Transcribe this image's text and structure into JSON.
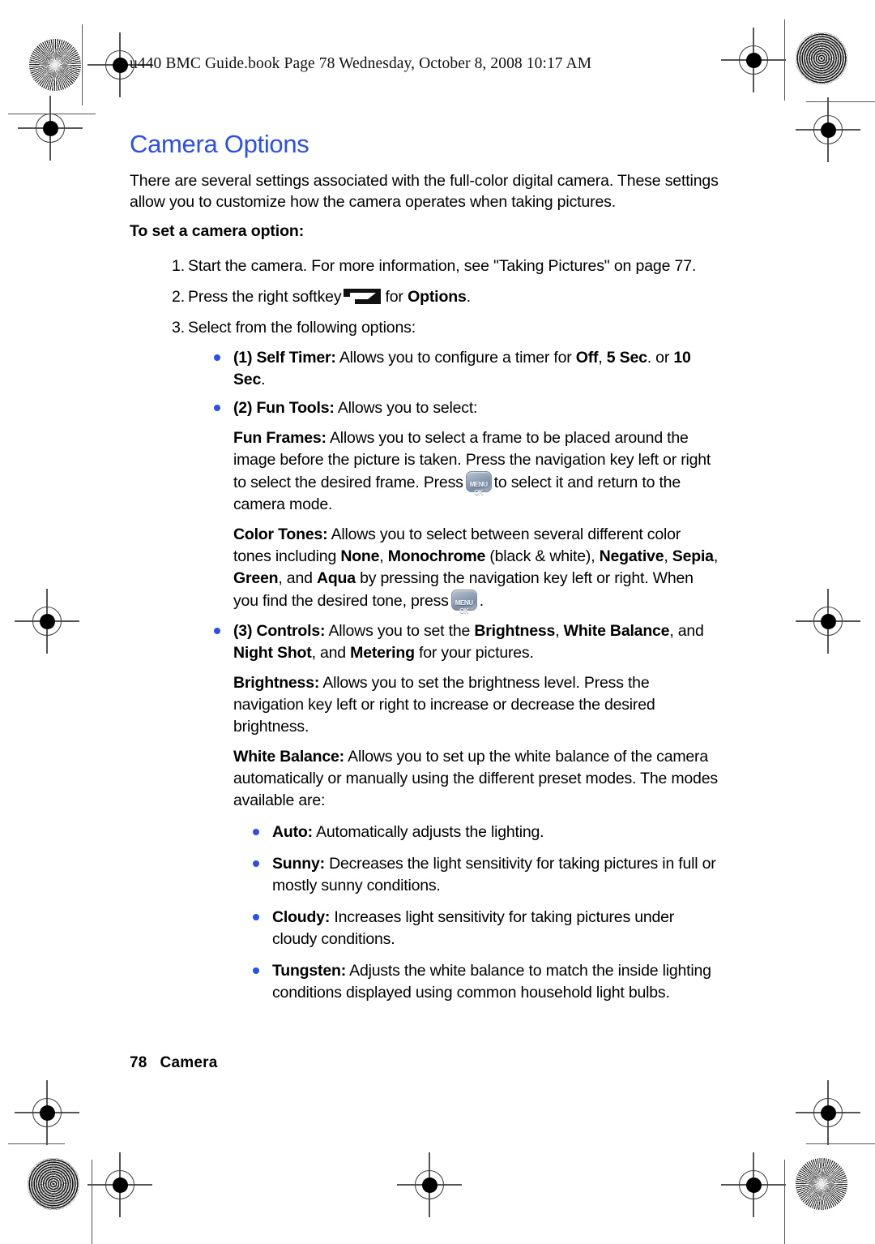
{
  "header": {
    "text": "u440 BMC Guide.book  Page 78  Wednesday, October 8, 2008  10:17 AM"
  },
  "colors": {
    "accent_blue": "#2b4fe8",
    "text": "#000000",
    "key_face": "#8fa0b4"
  },
  "title": "Camera Options",
  "intro": "There are several settings associated with the full-color digital camera. These settings allow you to customize how the camera operates when taking pictures.",
  "subhead": "To set a camera option:",
  "steps": [
    {
      "num": "1.",
      "text": "Start the camera. For more information, see \"Taking Pictures\" on page 77."
    },
    {
      "num": "2.",
      "pre": "Press the right softkey",
      "icon": "softkey-right-icon",
      "mid": "for",
      "bold": "Options",
      "post": "."
    },
    {
      "num": "3.",
      "text": "Select from the following options:"
    }
  ],
  "options": [
    {
      "label": "(1) Self Timer:",
      "body_1": "Allows you to configure a timer for",
      "b1": "Off",
      "sep1": ",",
      "b2": "5 Sec",
      "sep2": ". or",
      "b3": "10 Sec",
      "sep3": "."
    },
    {
      "label": "(2) Fun Tools:",
      "body_1": "Allows you to select:"
    },
    {
      "label": "(3) Controls:",
      "body_1": "Allows you to set the",
      "b1": "Brightness",
      "sep1": ",",
      "b2": "White Balance",
      "sep2": ", and",
      "b3": "Night Shot",
      "sep3": ", and",
      "b4": "Metering",
      "sep4": "for your pictures."
    }
  ],
  "fun_frames": {
    "label": "Fun Frames:",
    "part1": "Allows you to select a frame to be placed around the image before the picture is taken. Press the navigation key left or right to select the desired frame. Press",
    "icon": "menu-ok-key-icon",
    "part2": "to select it and return to the camera mode."
  },
  "color_tones": {
    "label": "Color Tones:",
    "part1": "Allows you to select between several different color tones including",
    "b1": "None",
    "s1": ",",
    "b2": "Monochrome",
    "s2": "(black & white),",
    "b3": "Negative",
    "s3": ",",
    "b4": "Sepia",
    "s4": ",",
    "b5": "Green",
    "s5": ", and",
    "b6": "Aqua",
    "s6": "by pressing the navigation key left or right. When you find the desired tone, press",
    "icon": "menu-ok-key-icon",
    "part2": "."
  },
  "brightness": {
    "label": "Brightness:",
    "text": "Allows you to set the brightness level. Press the navigation key left or right to increase or decrease the desired brightness."
  },
  "white_balance": {
    "label": "White Balance:",
    "text": "Allows you to set up the white balance of the camera automatically or manually using the different preset modes. The modes available are:",
    "modes": [
      {
        "label": "Auto:",
        "text": "Automatically adjusts the lighting."
      },
      {
        "label": "Sunny:",
        "text": "Decreases the light sensitivity for taking pictures in full or mostly sunny conditions."
      },
      {
        "label": "Cloudy:",
        "text": "Increases light sensitivity for taking pictures under cloudy conditions."
      },
      {
        "label": "Tungsten:",
        "text": "Adjusts the white balance to match the inside lighting conditions displayed using common household light bulbs."
      }
    ]
  },
  "keys": {
    "menu_ok_line1": "MENU",
    "menu_ok_line2": "OK"
  },
  "footer": {
    "page": "78",
    "section": "Camera"
  }
}
